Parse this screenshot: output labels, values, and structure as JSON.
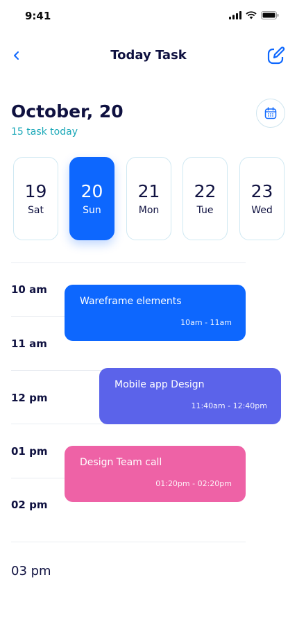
{
  "status_bar": {
    "time": "9:41"
  },
  "nav": {
    "title": "Today Task"
  },
  "header": {
    "date": "October, 20",
    "subtitle": "15 task today"
  },
  "days": [
    {
      "num": "19",
      "weekday": "Sat"
    },
    {
      "num": "20",
      "weekday": "Sun"
    },
    {
      "num": "21",
      "weekday": "Mon"
    },
    {
      "num": "22",
      "weekday": "Tue"
    },
    {
      "num": "23",
      "weekday": "Wed"
    }
  ],
  "selected_day": "20",
  "timeline": {
    "hours": [
      "10 am",
      "11 am",
      "12 pm",
      "01 pm",
      "02 pm",
      "03 pm"
    ]
  },
  "events": [
    {
      "title": "Wareframe elements",
      "time": "10am - 11am",
      "color": "#0d67fe"
    },
    {
      "title": "Mobile app Design",
      "time": "11:40am - 12:40pm",
      "color": "#5b63ea"
    },
    {
      "title": "Design Team call",
      "time": "01:20pm - 02:20pm",
      "color": "#ee62a6"
    }
  ],
  "colors": {
    "accent": "#0d67fe",
    "teal": "#1aa8b8",
    "text": "#0f1140"
  }
}
